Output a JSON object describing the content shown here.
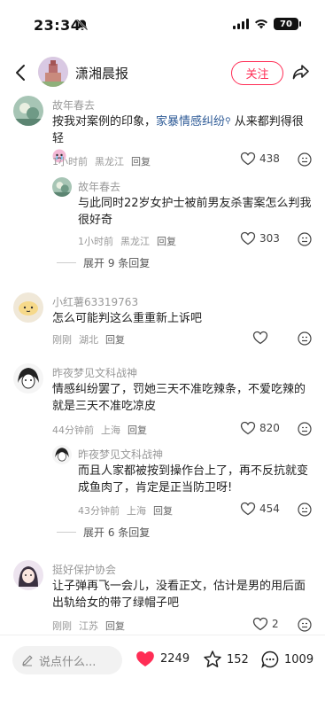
{
  "status_bar": {
    "time": "23:34",
    "battery": "70"
  },
  "header": {
    "brand": "潇湘晨报",
    "follow_label": "关注"
  },
  "comments": [
    {
      "name": "故年春去",
      "text_before": "按我对案例的印象，",
      "link": "家暴情感纠纷",
      "text_after": " 从来都判得很轻",
      "time": "1小时前",
      "region": "黑龙江",
      "reply": "回复",
      "likes": "438"
    },
    {
      "name": "故年春去",
      "text": "与此同时22岁女护士被前男友杀害案怎么判我很好奇",
      "time": "1小时前",
      "region": "黑龙江",
      "reply": "回复",
      "likes": "303",
      "expand": "展开 9 条回复"
    },
    {
      "name": "小红薯63319763",
      "text": "怎么可能判这么重重新上诉吧",
      "time": "刚刚",
      "region": "湖北",
      "reply": "回复",
      "likes": ""
    },
    {
      "name": "昨夜梦见文科战神",
      "text": "情感纠纷罢了，罚她三天不准吃辣条，不爱吃辣的就是三天不准吃凉皮",
      "time": "44分钟前",
      "region": "上海",
      "reply": "回复",
      "likes": "820"
    },
    {
      "name": "昨夜梦见文科战神",
      "text": "而且人家都被按到操作台上了，再不反抗就变成鱼肉了，肯定是正当防卫呀!",
      "time": "43分钟前",
      "region": "上海",
      "reply": "回复",
      "likes": "454",
      "expand": "展开 6 条回复"
    },
    {
      "name": "挺好保护协会",
      "text": "让子弹再飞一会儿，没看正文，估计是男的用后面出轨给女的带了绿帽子吧",
      "time": "刚刚",
      "region": "江苏",
      "reply": "回复",
      "likes": "2"
    }
  ],
  "bottom_bar": {
    "placeholder": "说点什么...",
    "likes": "2249",
    "stars": "152",
    "comments": "1009"
  },
  "colors": {
    "accent": "#ff2d55",
    "link": "#2d5a96"
  }
}
